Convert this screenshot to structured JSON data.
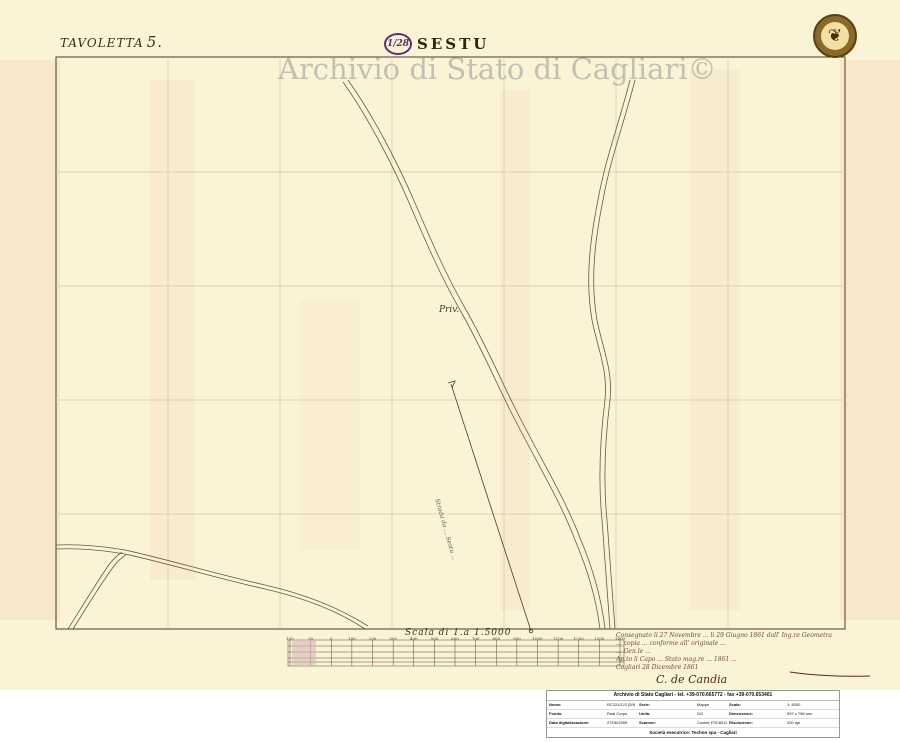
{
  "sheet": {
    "tavoletta_label": "TAVOLETTA",
    "tavoletta_number": "5.",
    "stamp_number": "1/28",
    "place_name": "SESTU",
    "watermark": "Archivio di Stato di Cagliari©",
    "seal_icon": "coat-of-arms-seal-icon"
  },
  "map": {
    "labels": {
      "privato": "Priv.",
      "road_note": "Strada da ... Sestu ..."
    },
    "scale": {
      "title": "Scala di 1.a 1.5000",
      "ticks": [
        "100",
        "50",
        "0",
        "100",
        "200",
        "300",
        "400",
        "500",
        "600",
        "700",
        "800",
        "900",
        "1000",
        "1100",
        "1200",
        "1300",
        "1400"
      ]
    },
    "certification": {
      "lines": [
        "Consegnato li 27 Novembre ... li 29 Giugno 1861 dall' Ing.re Geometra",
        "... copia ... conforme all' originale ...",
        "... Gen.le ...",
        "Ap.to li Capo ... Stato mag.re ... 1861 ...",
        "Cagliari 28 Dicembre 1861"
      ],
      "signature": "C. de Candia"
    }
  },
  "info_card": {
    "title": "Archivio di Stato Cagliari - tel. +39-070.665772 - fax +39-070.653401",
    "fields": [
      {
        "k": "Nome:",
        "v": "RC221/C/2 (5/f)"
      },
      {
        "k": "Serie:",
        "v": "Mappe"
      },
      {
        "k": "Scala:",
        "v": "1: 5000"
      },
      {
        "k": "Fondo:",
        "v": "Real Corpo"
      },
      {
        "k": "Unità:",
        "v": "D/2"
      },
      {
        "k": "Dimensione:",
        "v": "597 x 796 mm"
      },
      {
        "k": "Data digitalizzazione:",
        "v": "27/06/1999"
      },
      {
        "k": "Scanner:",
        "v": "Contex FSC8016"
      },
      {
        "k": "Risoluzione:",
        "v": "200 dpi"
      }
    ],
    "footer": "Società esecutrice: Techno spa - Cagliari"
  }
}
